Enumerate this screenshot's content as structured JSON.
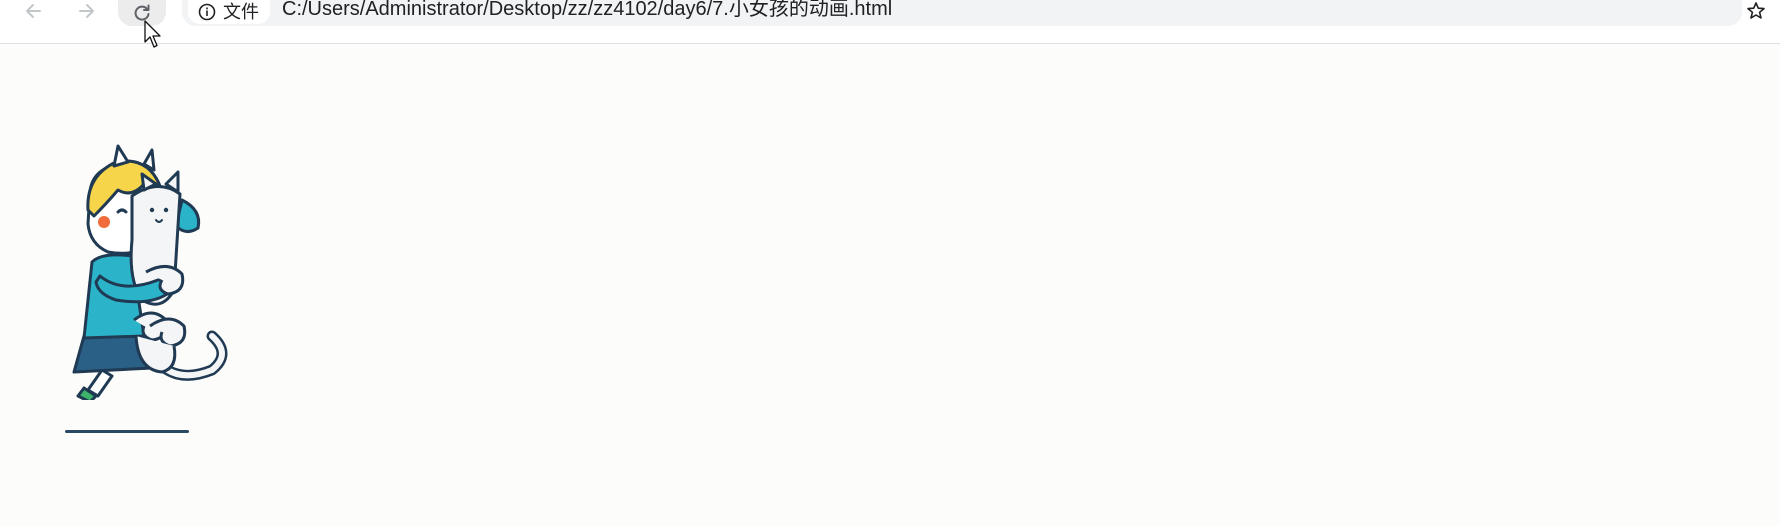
{
  "browser": {
    "security_chip_label": "文件",
    "url": "C:/Users/Administrator/Desktop/zz/zz4102/day6/7.小女孩的动画.html",
    "icons": [
      "back-arrow-icon",
      "forward-arrow-icon",
      "reload-icon",
      "info-icon",
      "star-icon",
      "mouse-cursor-icon"
    ]
  },
  "page": {
    "illustration": "girl-hugging-cat-icon",
    "colors": {
      "hair": "#f7d54a",
      "shirt": "#2bb3c9",
      "skirt": "#2a5f86",
      "outline": "#1f3a52",
      "cheek": "#f26b3a",
      "shoe": "#3cb56a",
      "cat": "#f3f5f6"
    }
  }
}
